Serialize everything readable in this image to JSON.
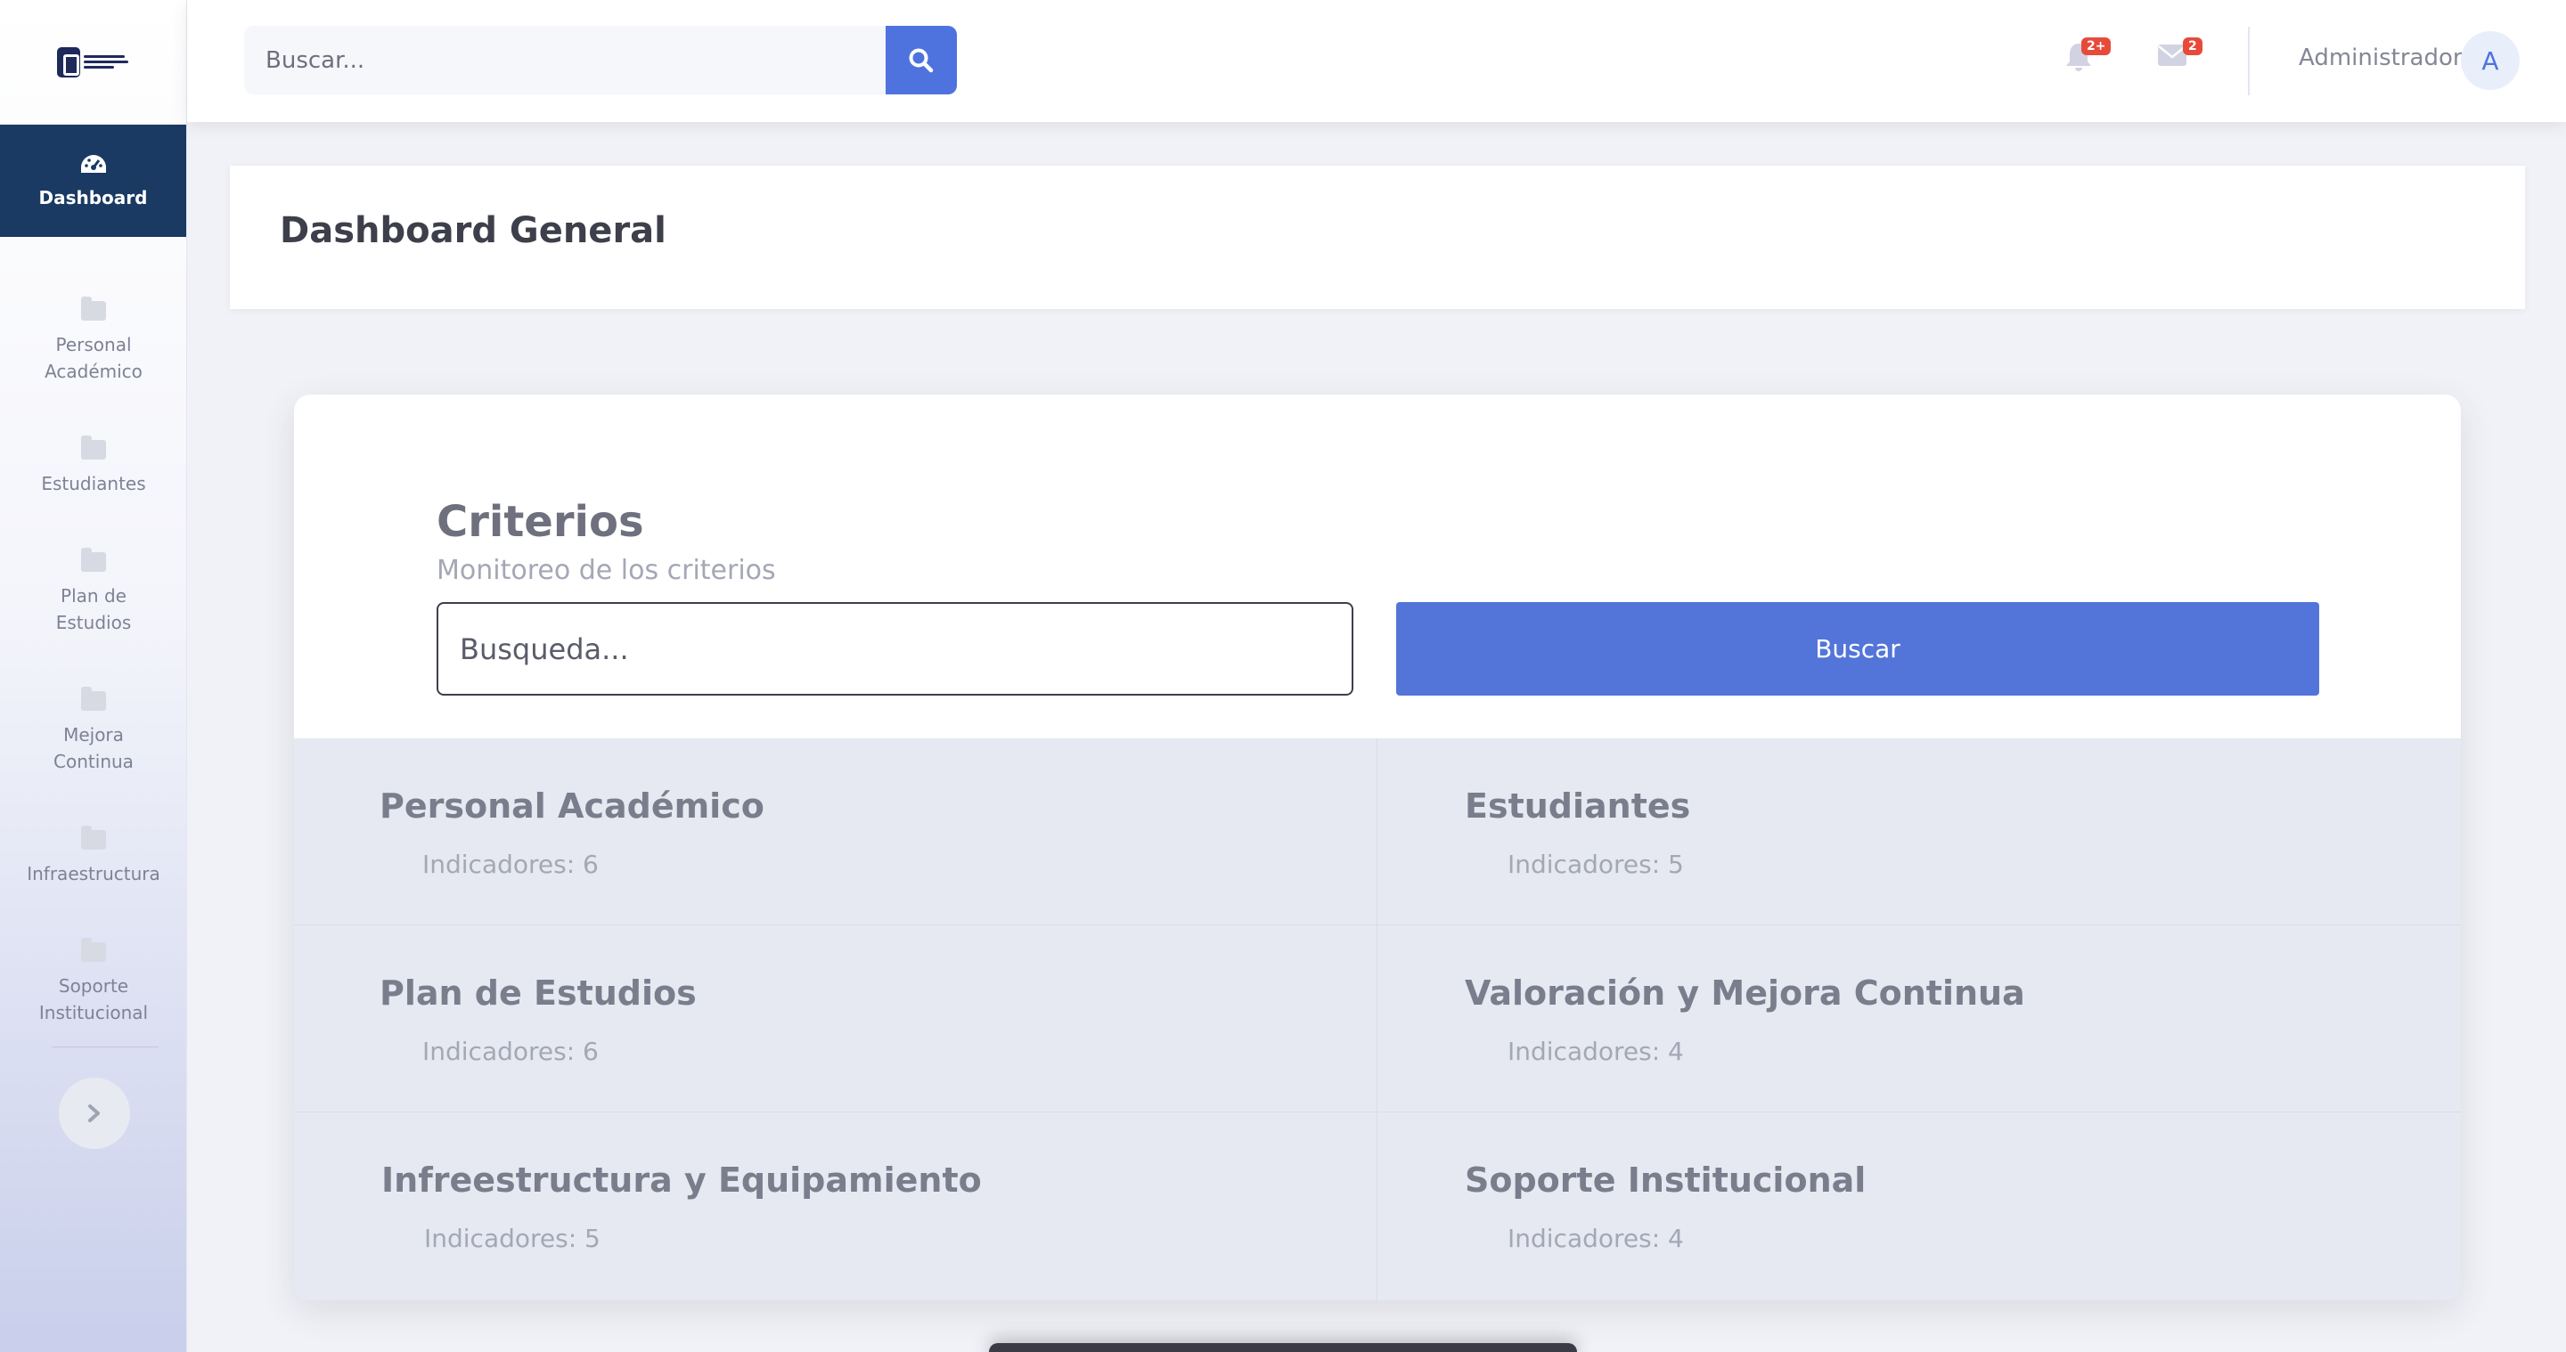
{
  "sidebar": {
    "brand_alt": "TECNOLÓGICO NACIONAL DE MÉXICO",
    "active_item": {
      "label": "Dashboard",
      "icon": "tachometer-icon"
    },
    "items": [
      {
        "label_lines": [
          "Personal",
          "Académico"
        ],
        "icon": "folder-icon"
      },
      {
        "label_lines": [
          "Estudiantes"
        ],
        "icon": "folder-icon"
      },
      {
        "label_lines": [
          "Plan de",
          "Estudios"
        ],
        "icon": "folder-icon"
      },
      {
        "label_lines": [
          "Mejora",
          "Continua"
        ],
        "icon": "folder-icon"
      },
      {
        "label_lines": [
          "Infraestructura"
        ],
        "icon": "folder-icon"
      },
      {
        "label_lines": [
          "Soporte",
          "Institucional"
        ],
        "icon": "folder-icon"
      }
    ],
    "toggle_icon": "chevron-right-icon"
  },
  "topbar": {
    "search_placeholder": "Buscar...",
    "search_icon": "search-icon",
    "alerts_badge": "2+",
    "messages_badge": "2",
    "user_name": "Administrador",
    "avatar_initial": "A"
  },
  "page": {
    "title": "Dashboard General"
  },
  "criteria": {
    "title": "Criterios",
    "subtitle": "Monitoreo de los criterios",
    "search_placeholder": "Busqueda...",
    "search_button": "Buscar",
    "categories": [
      {
        "name": "Personal Académico",
        "indicators": "Indicadores: 6"
      },
      {
        "name": "Estudiantes",
        "indicators": "Indicadores: 5"
      },
      {
        "name": "Plan de Estudios",
        "indicators": "Indicadores: 6"
      },
      {
        "name": "Valoración y Mejora Continua",
        "indicators": "Indicadores: 4"
      },
      {
        "name": "Infreestructura y Equipamiento",
        "indicators": "Indicadores: 5"
      },
      {
        "name": "Soporte Institucional",
        "indicators": "Indicadores: 4"
      }
    ]
  },
  "colors": {
    "primary": "#4e73df",
    "sidebar_active": "#1a3a63",
    "badge": "#e74a3b"
  }
}
